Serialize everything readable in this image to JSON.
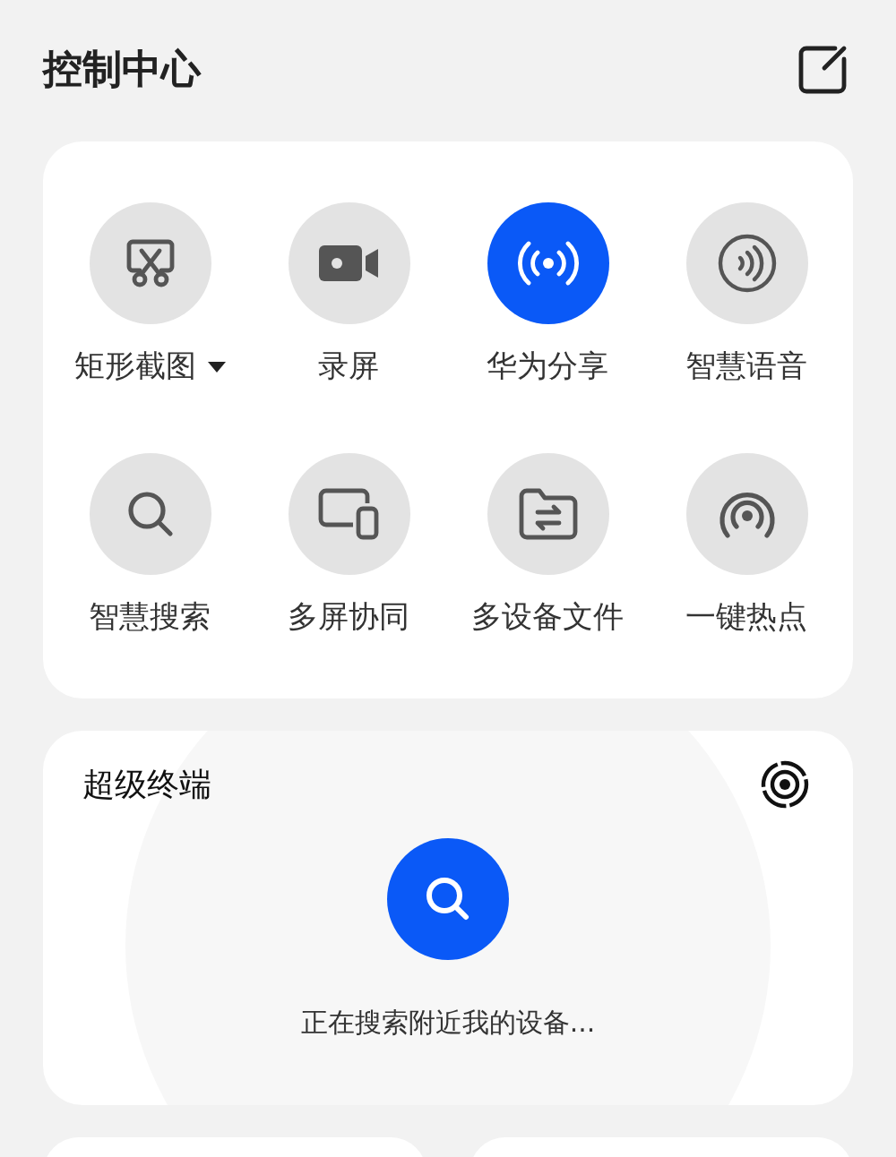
{
  "header": {
    "title": "控制中心"
  },
  "tiles": [
    {
      "label": "矩形截图",
      "kind": "screenshot",
      "active": false,
      "has_menu": true
    },
    {
      "label": "录屏",
      "kind": "record",
      "active": false,
      "has_menu": false
    },
    {
      "label": "华为分享",
      "kind": "share",
      "active": true,
      "has_menu": false
    },
    {
      "label": "智慧语音",
      "kind": "voice",
      "active": false,
      "has_menu": false
    },
    {
      "label": "智慧搜索",
      "kind": "search",
      "active": false,
      "has_menu": false
    },
    {
      "label": "多屏协同",
      "kind": "multiscreen",
      "active": false,
      "has_menu": false
    },
    {
      "label": "多设备文件",
      "kind": "files",
      "active": false,
      "has_menu": false
    },
    {
      "label": "一键热点",
      "kind": "hotspot",
      "active": false,
      "has_menu": false
    }
  ],
  "super_device": {
    "title": "超级终端",
    "status": "正在搜索附近我的设备..."
  }
}
